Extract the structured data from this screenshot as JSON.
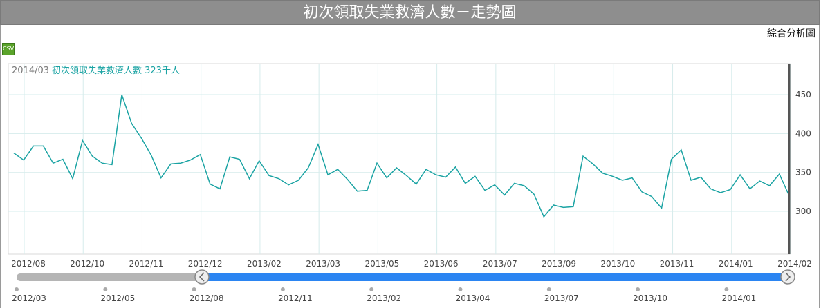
{
  "page_title": "初次領取失業救濟人數－走勢圖",
  "analysis_link": "綜合分析圖",
  "csv_label": "CSV",
  "info": {
    "period": "2014/03",
    "series_label": "初次領取失業救濟人數 323千人"
  },
  "colors": {
    "series": "#1aa3a3",
    "grid": "#d6ecec",
    "slider_fill": "#2b85f2",
    "slider_track": "#b5b5b5",
    "title_bg": "#8e8e8e"
  },
  "chart_data": {
    "type": "line",
    "title": "初次領取失業救濟人數－走勢圖",
    "x_tick_labels": [
      "2012/08",
      "2012/10",
      "2012/11",
      "2012/12",
      "2013/02",
      "2013/03",
      "2013/05",
      "2013/06",
      "2013/07",
      "2013/09",
      "2013/10",
      "2013/11",
      "2014/01",
      "2014/02"
    ],
    "y_ticks": [
      300,
      350,
      400,
      450
    ],
    "ylim": [
      245,
      490
    ],
    "grid": true,
    "series": [
      {
        "values": [
          375,
          366,
          384,
          384,
          362,
          367,
          342,
          391,
          371,
          362,
          360,
          450,
          413,
          394,
          372,
          343,
          361,
          362,
          366,
          373,
          335,
          329,
          370,
          367,
          342,
          365,
          346,
          342,
          334,
          340,
          356,
          386,
          347,
          354,
          341,
          326,
          327,
          362,
          343,
          356,
          346,
          335,
          354,
          347,
          344,
          357,
          336,
          345,
          327,
          334,
          321,
          336,
          333,
          322,
          293,
          308,
          305,
          306,
          371,
          361,
          349,
          345,
          340,
          343,
          325,
          319,
          304,
          367,
          379,
          340,
          344,
          329,
          324,
          328,
          347,
          329,
          339,
          333,
          348,
          320
        ]
      }
    ],
    "navigator_labels": [
      "2012/03",
      "2012/05",
      "2012/08",
      "2012/11",
      "2013/02",
      "2013/04",
      "2013/07",
      "2013/10",
      "2014/01"
    ]
  }
}
